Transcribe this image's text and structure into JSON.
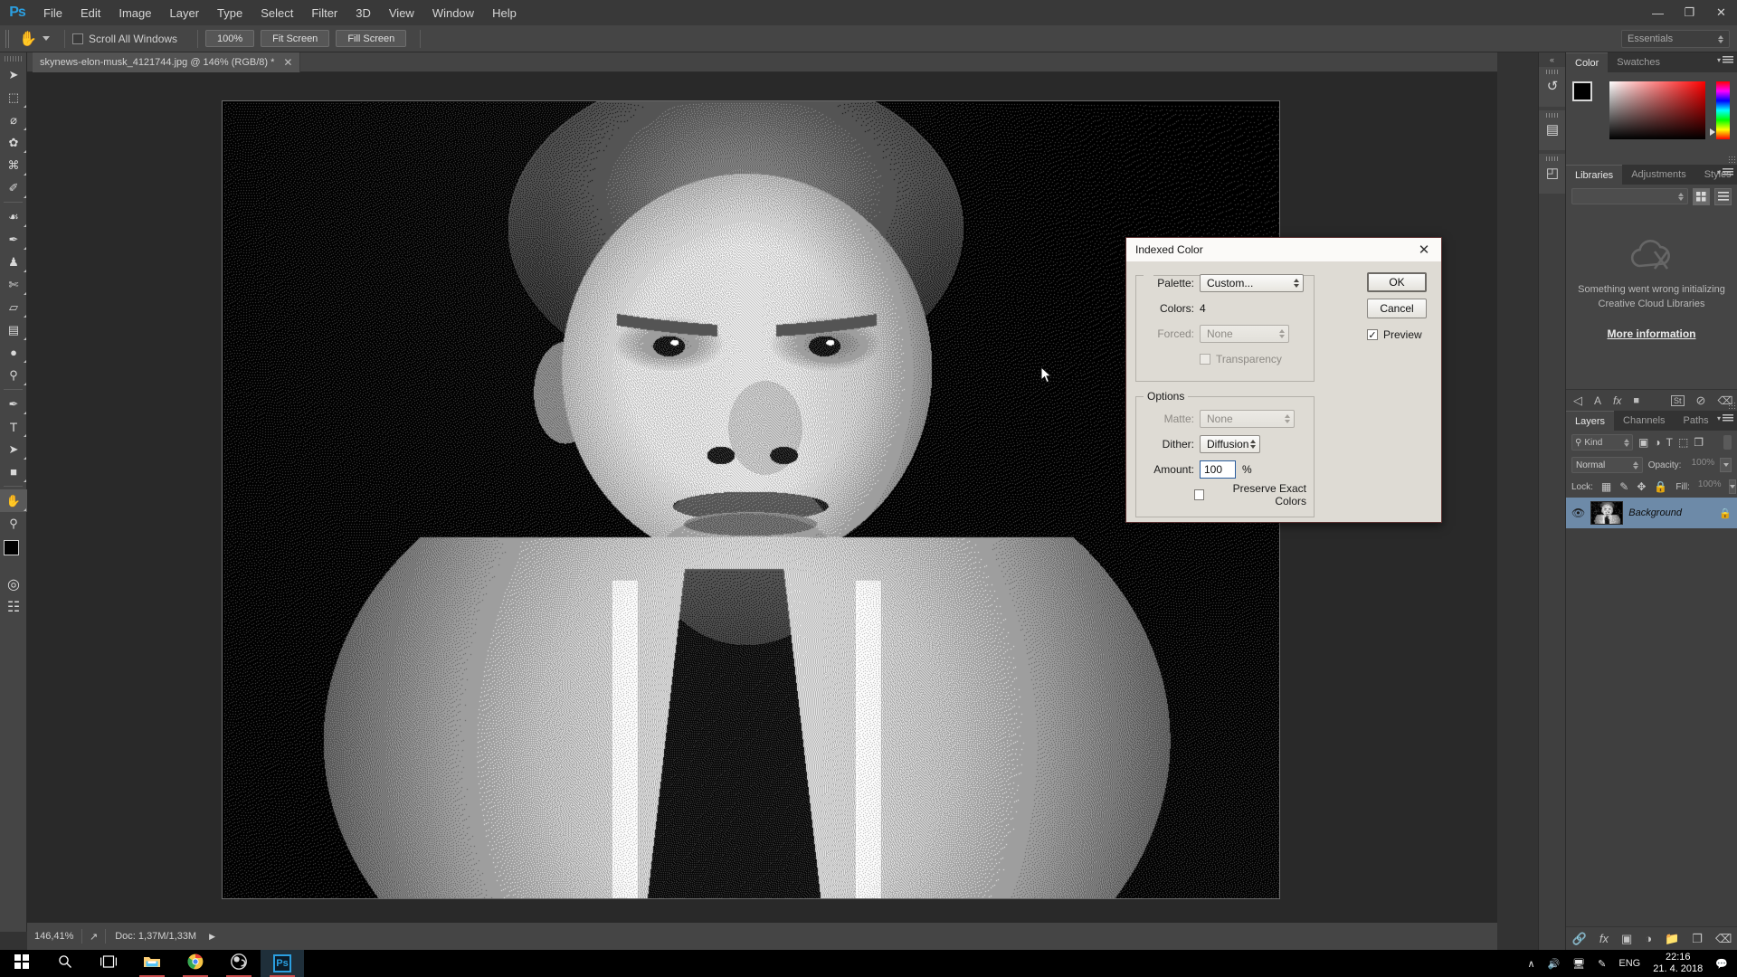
{
  "app": {
    "name": "Adobe Photoshop",
    "logo_text": "Ps",
    "workspace": "Essentials"
  },
  "menubar": {
    "items": [
      "File",
      "Edit",
      "Image",
      "Layer",
      "Type",
      "Select",
      "Filter",
      "3D",
      "View",
      "Window",
      "Help"
    ],
    "window_controls": {
      "minimize": "—",
      "restore": "❐",
      "close": "✕"
    }
  },
  "options_bar": {
    "tool_icon": "hand-tool-icon",
    "scroll_all_windows_label": "Scroll All Windows",
    "scroll_all_windows_checked": false,
    "buttons": [
      "100%",
      "Fit Screen",
      "Fill Screen"
    ]
  },
  "document_tab": {
    "title": "skynews-elon-musk_4121744.jpg @ 146% (RGB/8) *",
    "close_glyph": "✕"
  },
  "toolbar": {
    "tools": [
      {
        "name": "move-tool",
        "glyph": "➤",
        "has_corner": false,
        "selected": false
      },
      {
        "name": "rectangular-marquee-tool",
        "glyph": "⬚",
        "has_corner": true,
        "selected": false
      },
      {
        "name": "lasso-tool",
        "glyph": "⌀",
        "has_corner": true,
        "selected": false
      },
      {
        "name": "quick-selection-tool",
        "glyph": "✿",
        "has_corner": true,
        "selected": false
      },
      {
        "name": "crop-tool",
        "glyph": "⌘",
        "has_corner": true,
        "selected": false
      },
      {
        "name": "eyedropper-tool",
        "glyph": "✐",
        "has_corner": true,
        "selected": false
      },
      {
        "name": "spot-healing-brush-tool",
        "glyph": "☙",
        "has_corner": true,
        "selected": false
      },
      {
        "name": "brush-tool",
        "glyph": "✒",
        "has_corner": true,
        "selected": false
      },
      {
        "name": "clone-stamp-tool",
        "glyph": "♟",
        "has_corner": true,
        "selected": false
      },
      {
        "name": "history-brush-tool",
        "glyph": "✄",
        "has_corner": true,
        "selected": false
      },
      {
        "name": "eraser-tool",
        "glyph": "▱",
        "has_corner": true,
        "selected": false
      },
      {
        "name": "gradient-tool",
        "glyph": "▤",
        "has_corner": true,
        "selected": false
      },
      {
        "name": "blur-tool",
        "glyph": "●",
        "has_corner": true,
        "selected": false
      },
      {
        "name": "dodge-tool",
        "glyph": "⚲",
        "has_corner": true,
        "selected": false
      },
      {
        "name": "pen-tool",
        "glyph": "✒",
        "has_corner": true,
        "selected": false
      },
      {
        "name": "type-tool",
        "glyph": "T",
        "has_corner": true,
        "selected": false
      },
      {
        "name": "path-selection-tool",
        "glyph": "➤",
        "has_corner": true,
        "selected": false
      },
      {
        "name": "rectangle-tool",
        "glyph": "■",
        "has_corner": true,
        "selected": false
      },
      {
        "name": "hand-tool",
        "glyph": "✋",
        "has_corner": true,
        "selected": true
      },
      {
        "name": "zoom-tool",
        "glyph": "⚲",
        "has_corner": false,
        "selected": false
      }
    ],
    "foreground_color": "#000000",
    "background_color": "#ffffff",
    "quick_mask_icon": "quick-mask-icon",
    "screen_mode_icon": "screen-mode-icon"
  },
  "status_bar": {
    "zoom": "146,41%",
    "doc_info": "Doc: 1,37M/1,33M",
    "share_icon": "share-icon",
    "expand_glyph": "▶"
  },
  "right_rail": {
    "collapse_glyph": "«",
    "buttons": [
      {
        "name": "history-panel-icon",
        "glyph": "↺"
      },
      {
        "name": "properties-panel-icon",
        "glyph": "▤"
      },
      {
        "name": "layer-comps-panel-icon",
        "glyph": "◰"
      }
    ]
  },
  "color_panel": {
    "tabs": [
      {
        "label": "Color",
        "active": true
      },
      {
        "label": "Swatches",
        "active": false
      }
    ],
    "foreground": "#000000",
    "background": "#ffffff",
    "menu_icon": "panel-menu-icon"
  },
  "libraries_panel": {
    "tabs": [
      {
        "label": "Libraries",
        "active": true
      },
      {
        "label": "Adjustments",
        "active": false
      },
      {
        "label": "Styles",
        "active": false
      }
    ],
    "error_line1": "Something went wrong initializing",
    "error_line2": "Creative Cloud Libraries",
    "more_information": "More information",
    "cloud_icon": "cloud-error-icon",
    "grid_view_icon": "grid-view-icon",
    "list_view_icon": "list-view-icon",
    "footer_icons": [
      {
        "name": "add-graphic-icon",
        "glyph": "◁"
      },
      {
        "name": "add-character-style-icon",
        "glyph": "A"
      },
      {
        "name": "add-layer-style-icon",
        "glyph": "fx"
      },
      {
        "name": "add-fill-color-icon",
        "glyph": "■"
      },
      {
        "name": "create-new-library-icon",
        "glyph": "St"
      },
      {
        "name": "sync-error-icon",
        "glyph": "⊘"
      },
      {
        "name": "delete-icon",
        "glyph": "Ὕ1"
      }
    ]
  },
  "layers_panel": {
    "tabs": [
      {
        "label": "Layers",
        "active": true
      },
      {
        "label": "Channels",
        "active": false
      },
      {
        "label": "Paths",
        "active": false
      }
    ],
    "filter_kind": "Kind",
    "filter_icons": [
      {
        "name": "filter-pixel-layers-icon",
        "glyph": "▣"
      },
      {
        "name": "filter-adjustment-layers-icon",
        "glyph": "◑"
      },
      {
        "name": "filter-type-layers-icon",
        "glyph": "T"
      },
      {
        "name": "filter-shape-layers-icon",
        "glyph": "⬚"
      },
      {
        "name": "filter-smart-objects-icon",
        "glyph": "❐"
      }
    ],
    "blend_mode": "Normal",
    "opacity_label": "Opacity:",
    "opacity_value": "100%",
    "fill_label": "Fill:",
    "fill_value": "100%",
    "lock_label": "Lock:",
    "lock_icons": [
      {
        "name": "lock-transparent-pixels-icon",
        "glyph": "▦"
      },
      {
        "name": "lock-image-pixels-icon",
        "glyph": "✒"
      },
      {
        "name": "lock-position-icon",
        "glyph": "✥"
      },
      {
        "name": "lock-all-icon",
        "glyph": "ὑ2"
      }
    ],
    "layers": [
      {
        "name": "Background",
        "visible": true,
        "locked": true,
        "selected": true
      }
    ],
    "footer_icons": [
      {
        "name": "link-layers-icon",
        "glyph": "🔗"
      },
      {
        "name": "add-layer-style-icon",
        "glyph": "fx"
      },
      {
        "name": "add-layer-mask-icon",
        "glyph": "▣"
      },
      {
        "name": "new-fill-adjustment-layer-icon",
        "glyph": "◑"
      },
      {
        "name": "new-group-icon",
        "glyph": "🗀"
      },
      {
        "name": "new-layer-icon",
        "glyph": "❐"
      },
      {
        "name": "delete-layer-icon",
        "glyph": "🗑"
      }
    ]
  },
  "dialog": {
    "title": "Indexed Color",
    "close_glyph": "✕",
    "palette_label": "Palette:",
    "palette_value": "Custom...",
    "colors_label": "Colors:",
    "colors_value": "4",
    "forced_label": "Forced:",
    "forced_value": "None",
    "forced_disabled": true,
    "transparency_label": "Transparency",
    "transparency_checked": false,
    "transparency_disabled": true,
    "options_legend": "Options",
    "matte_label": "Matte:",
    "matte_value": "None",
    "matte_disabled": true,
    "dither_label": "Dither:",
    "dither_value": "Diffusion",
    "amount_label": "Amount:",
    "amount_value": "100",
    "amount_unit": "%",
    "preserve_label": "Preserve Exact Colors",
    "preserve_checked": false,
    "ok_label": "OK",
    "cancel_label": "Cancel",
    "preview_label": "Preview",
    "preview_checked": true,
    "check_glyph": "✓"
  },
  "canvas": {
    "image_name": "skynews-elon-musk_4121744.jpg",
    "description": "dithered black-and-white indexed-color portrait"
  },
  "taskbar": {
    "items": [
      {
        "name": "start-button-icon",
        "glyph": "⊞",
        "active": false,
        "running": false
      },
      {
        "name": "search-icon",
        "glyph": "⚲",
        "active": false,
        "running": false
      },
      {
        "name": "task-view-icon",
        "glyph": "❐",
        "active": false,
        "running": false
      },
      {
        "name": "file-explorer-icon",
        "glyph": "📁",
        "active": false,
        "running": true
      },
      {
        "name": "google-chrome-icon",
        "glyph": "◉",
        "active": false,
        "running": true
      },
      {
        "name": "obs-studio-icon",
        "glyph": "●",
        "active": false,
        "running": true
      },
      {
        "name": "photoshop-taskbar-icon",
        "glyph": "Ps",
        "active": true,
        "running": true
      }
    ],
    "tray": {
      "show_hidden_glyph": "∧",
      "volume_icon": "volume-icon",
      "network_icon": "network-icon",
      "pen_icon": "pen-icon",
      "language": "ENG",
      "time": "22:16",
      "date": "21. 4. 2018",
      "notifications_icon": "notifications-icon"
    }
  },
  "colors": {
    "menubar_bg": "#393939",
    "panel_bg": "#454545",
    "canvas_bg": "#292929",
    "dialog_bg": "#dedbd4",
    "layer_selected": "#6d8aa8",
    "accent_blue": "#2b9fe0"
  }
}
